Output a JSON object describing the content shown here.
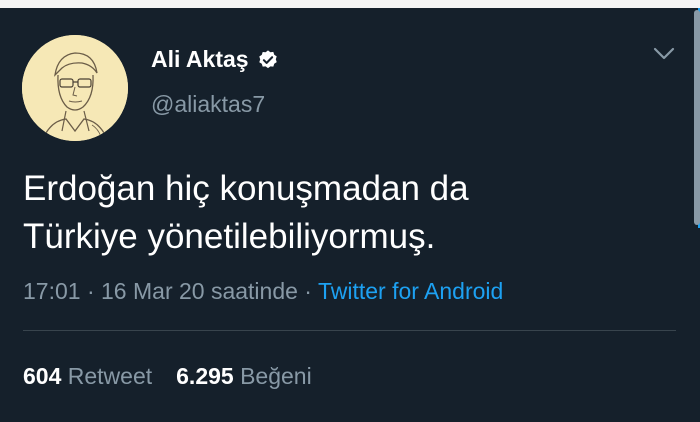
{
  "colors": {
    "background": "#15202b",
    "primary_text": "#ffffff",
    "secondary_text": "#8899a6",
    "accent": "#1da1f2",
    "divider": "#38444d"
  },
  "tweet": {
    "author": {
      "display_name": "Ali Aktaş",
      "handle": "@aliaktas7",
      "verified": true,
      "avatar_icon": "sketch-portrait-avatar"
    },
    "text_lines": [
      "Erdoğan hiç konuşmadan da",
      "Türkiye yönetilebiliyormuş."
    ],
    "meta": {
      "time": "17:01",
      "separator": " · ",
      "date_phrase": "16 Mar 20 saatinde",
      "source": "Twitter for Android"
    },
    "stats": {
      "retweet_count": "604",
      "retweet_label": "Retweet",
      "like_count": "6.295",
      "like_label": "Beğeni"
    },
    "menu_icon": "chevron-down-icon"
  }
}
